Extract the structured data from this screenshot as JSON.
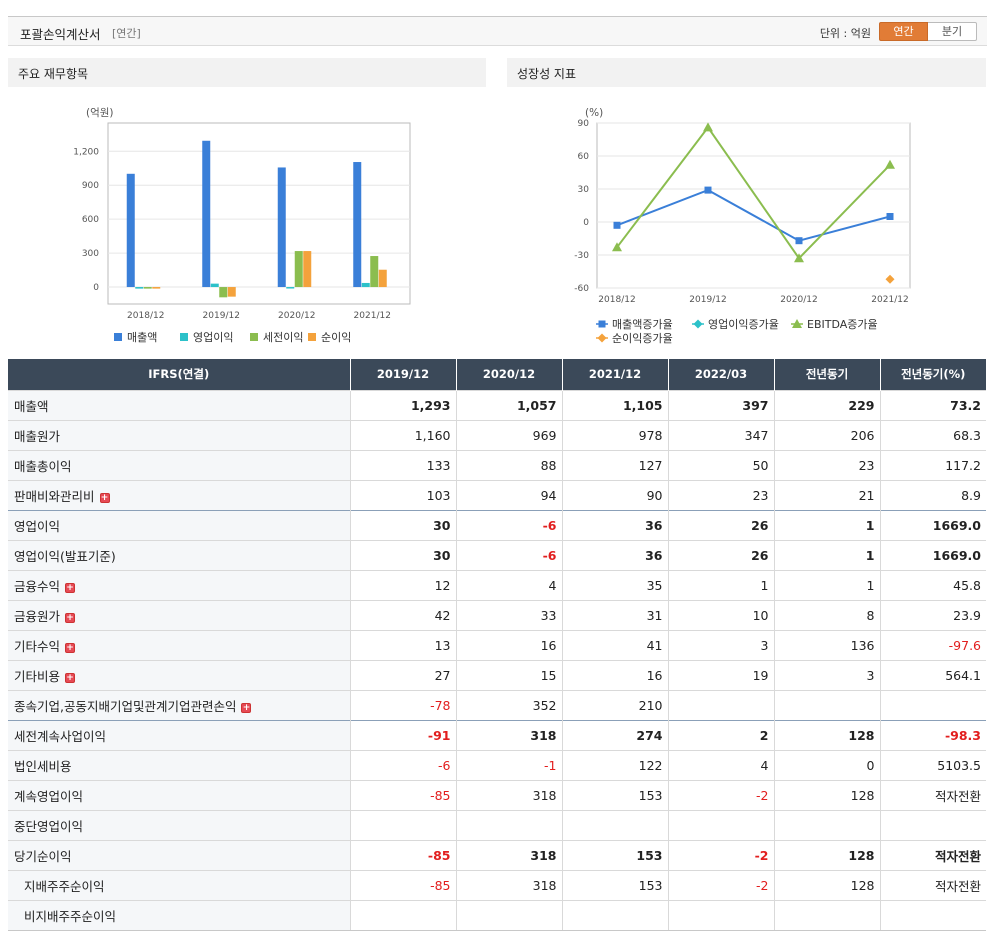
{
  "header": {
    "title": "포괄손익계산서",
    "period": "[연간]",
    "unit": "단위 : 억원",
    "tab_annual": "연간",
    "tab_quarter": "분기"
  },
  "panels": {
    "left_title": "주요 재무항목",
    "right_title": "성장성 지표"
  },
  "chart_data": [
    {
      "type": "bar",
      "title": "주요 재무항목",
      "ylabel": "(억원)",
      "categories": [
        "2018/12",
        "2019/12",
        "2020/12",
        "2021/12"
      ],
      "ylim": [
        -150,
        1450
      ],
      "yticks": [
        0,
        300,
        600,
        900,
        1200
      ],
      "ytick_labels": [
        "0",
        "300",
        "600",
        "900",
        "1,200"
      ],
      "grid": true,
      "legend_position": "bottom",
      "series": [
        {
          "name": "매출액",
          "color": "#3a7fd8",
          "values": [
            1001,
            1293,
            1057,
            1105
          ]
        },
        {
          "name": "영업이익",
          "color": "#2cc1c9",
          "values": [
            -14,
            30,
            -6,
            36
          ]
        },
        {
          "name": "세전이익",
          "color": "#8bbd4f",
          "values": [
            -14,
            -91,
            318,
            274
          ]
        },
        {
          "name": "순이익",
          "color": "#f4a23c",
          "values": [
            -14,
            -85,
            318,
            153
          ]
        }
      ]
    },
    {
      "type": "line",
      "title": "성장성 지표",
      "ylabel": "(%)",
      "categories": [
        "2018/12",
        "2019/12",
        "2020/12",
        "2021/12"
      ],
      "ylim": [
        -60,
        90
      ],
      "yticks": [
        -60,
        -30,
        0,
        30,
        60,
        90
      ],
      "ytick_labels": [
        "-60",
        "-30",
        "0",
        "30",
        "60",
        "90"
      ],
      "grid": true,
      "legend_position": "bottom",
      "series": [
        {
          "name": "매출액증가율",
          "color": "#3a7fd8",
          "marker": "square",
          "values": [
            -3,
            29,
            -17,
            5
          ]
        },
        {
          "name": "영업이익증가율",
          "color": "#2cc1c9",
          "marker": "diamond",
          "values": [
            null,
            null,
            null,
            null
          ]
        },
        {
          "name": "EBITDA증가율",
          "color": "#8bbd4f",
          "marker": "triangle",
          "values": [
            -23,
            86,
            -33,
            52
          ]
        },
        {
          "name": "순이익증가율",
          "color": "#f4a23c",
          "marker": "diamond",
          "values": [
            null,
            null,
            null,
            -52
          ]
        }
      ]
    }
  ],
  "table": {
    "headers": [
      "IFRS(연결)",
      "2019/12",
      "2020/12",
      "2021/12",
      "2022/03",
      "전년동기",
      "전년동기(%)"
    ],
    "rows": [
      {
        "label": "매출액",
        "values": [
          "1,293",
          "1,057",
          "1,105",
          "397",
          "229",
          "73.2"
        ],
        "bold": true,
        "expand": false
      },
      {
        "label": "매출원가",
        "values": [
          "1,160",
          "969",
          "978",
          "347",
          "206",
          "68.3"
        ],
        "bold": false,
        "expand": false
      },
      {
        "label": "매출총이익",
        "values": [
          "133",
          "88",
          "127",
          "50",
          "23",
          "117.2"
        ],
        "bold": false,
        "expand": false
      },
      {
        "label": "판매비와관리비",
        "values": [
          "103",
          "94",
          "90",
          "23",
          "21",
          "8.9"
        ],
        "bold": false,
        "expand": true
      },
      {
        "label": "영업이익",
        "values": [
          "30",
          "-6",
          "36",
          "26",
          "1",
          "1669.0"
        ],
        "bold": true,
        "expand": false,
        "sep": true
      },
      {
        "label": "영업이익(발표기준)",
        "values": [
          "30",
          "-6",
          "36",
          "26",
          "1",
          "1669.0"
        ],
        "bold": true,
        "expand": false
      },
      {
        "label": "금융수익",
        "values": [
          "12",
          "4",
          "35",
          "1",
          "1",
          "45.8"
        ],
        "bold": false,
        "expand": true
      },
      {
        "label": "금융원가",
        "values": [
          "42",
          "33",
          "31",
          "10",
          "8",
          "23.9"
        ],
        "bold": false,
        "expand": true
      },
      {
        "label": "기타수익",
        "values": [
          "13",
          "16",
          "41",
          "3",
          "136",
          "-97.6"
        ],
        "bold": false,
        "expand": true
      },
      {
        "label": "기타비용",
        "values": [
          "27",
          "15",
          "16",
          "19",
          "3",
          "564.1"
        ],
        "bold": false,
        "expand": true
      },
      {
        "label": "종속기업,공동지배기업및관계기업관련손익",
        "values": [
          "-78",
          "352",
          "210",
          "",
          "",
          ""
        ],
        "bold": false,
        "expand": true
      },
      {
        "label": "세전계속사업이익",
        "values": [
          "-91",
          "318",
          "274",
          "2",
          "128",
          "-98.3"
        ],
        "bold": true,
        "expand": false,
        "sep": true
      },
      {
        "label": "법인세비용",
        "values": [
          "-6",
          "-1",
          "122",
          "4",
          "0",
          "5103.5"
        ],
        "bold": false,
        "expand": false
      },
      {
        "label": "계속영업이익",
        "values": [
          "-85",
          "318",
          "153",
          "-2",
          "128",
          "적자전환"
        ],
        "bold": false,
        "expand": false
      },
      {
        "label": "중단영업이익",
        "values": [
          "",
          "",
          "",
          "",
          "",
          ""
        ],
        "bold": false,
        "expand": false
      },
      {
        "label": "당기순이익",
        "values": [
          "-85",
          "318",
          "153",
          "-2",
          "128",
          "적자전환"
        ],
        "bold": true,
        "expand": false
      },
      {
        "label": "지배주주순이익",
        "values": [
          "-85",
          "318",
          "153",
          "-2",
          "128",
          "적자전환"
        ],
        "bold": false,
        "expand": false,
        "child": true
      },
      {
        "label": "비지배주주순이익",
        "values": [
          "",
          "",
          "",
          "",
          "",
          ""
        ],
        "bold": false,
        "expand": false,
        "child": true
      }
    ]
  }
}
